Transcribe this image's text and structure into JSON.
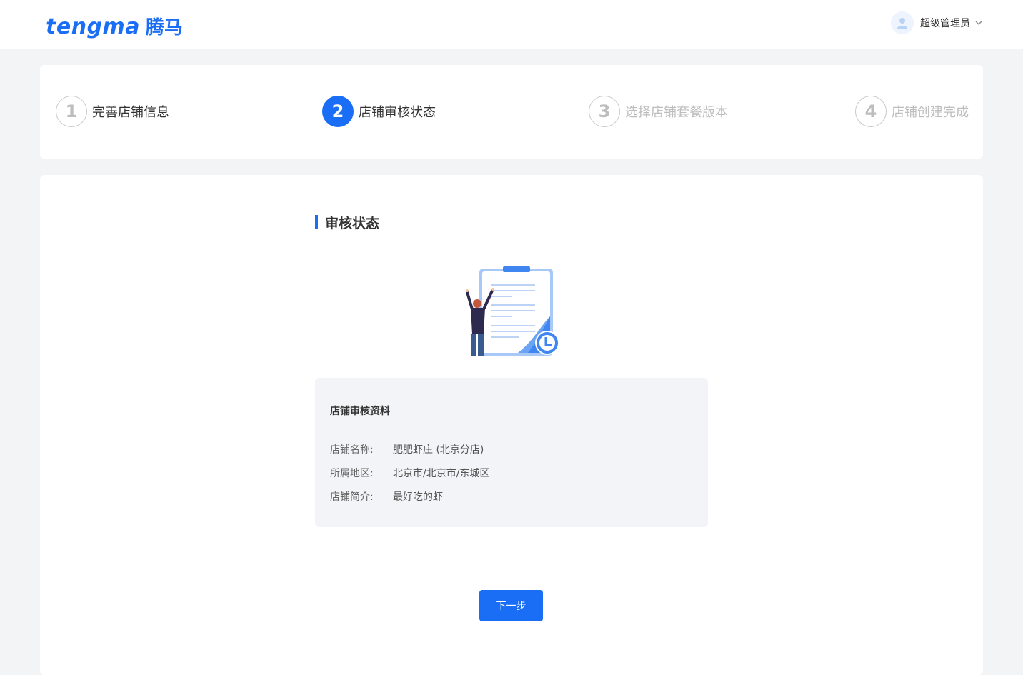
{
  "header": {
    "logo_en": "tengma",
    "logo_cn": "腾马",
    "user_name": "超级管理员",
    "user_icon": "avatar-icon",
    "dropdown_icon": "chevron-down-icon"
  },
  "steps": [
    {
      "number": "1",
      "label": "完善店铺信息",
      "state": "done"
    },
    {
      "number": "2",
      "label": "店铺审核状态",
      "state": "active"
    },
    {
      "number": "3",
      "label": "选择店铺套餐版本",
      "state": "pending"
    },
    {
      "number": "4",
      "label": "店铺创建完成",
      "state": "pending"
    }
  ],
  "main": {
    "section_title": "审核状态",
    "info": {
      "heading": "店铺审核资料",
      "rows": [
        {
          "key": "店铺名称:",
          "value": "肥肥虾庄 (北京分店)"
        },
        {
          "key": "所属地区:",
          "value": "北京市/北京市/东城区"
        },
        {
          "key": "店铺简介:",
          "value": "最好吃的虾"
        }
      ]
    },
    "next_button": "下一步"
  },
  "colors": {
    "primary": "#1a6ef5",
    "page_bg": "#f3f4f6",
    "info_bg": "#f2f4f7"
  }
}
